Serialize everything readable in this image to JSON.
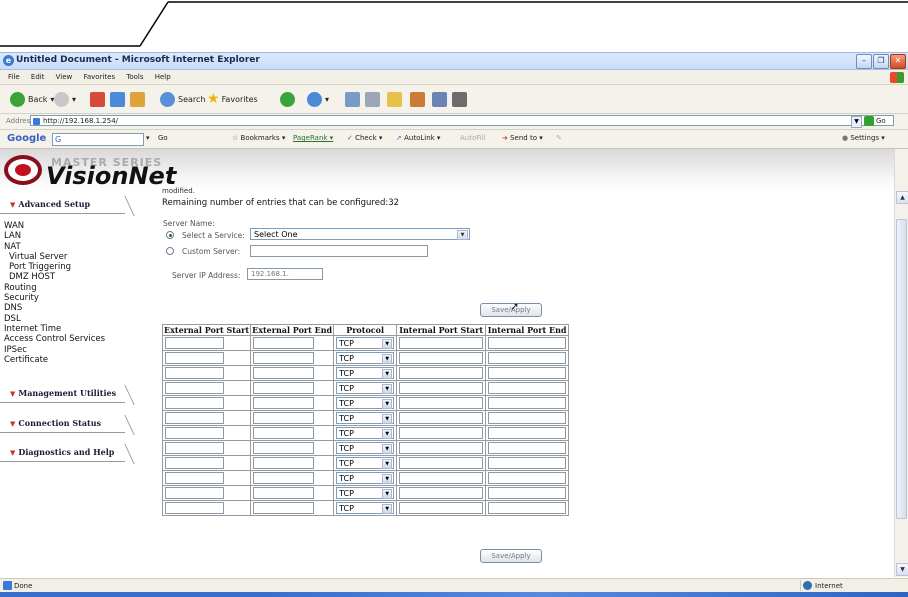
{
  "window": {
    "title": "Untitled Document - Microsoft Internet Explorer"
  },
  "menu": [
    "File",
    "Edit",
    "View",
    "Favorites",
    "Tools",
    "Help"
  ],
  "toolbar": {
    "back_label": "Back",
    "search_label": "Search",
    "favorites_label": "Favorites"
  },
  "address": {
    "label": "Address",
    "url": "http://192.168.1.254/",
    "go_label": "Go"
  },
  "google_bar": {
    "logo": "Google",
    "g_label": "G",
    "go_label": "Go",
    "bookmarks_label": "Bookmarks",
    "pagerank_label": "PageRank",
    "check_label": "Check",
    "autolink_label": "AutoLink",
    "autofill_label": "AutoFill",
    "sendto_label": "Send to",
    "settings_label": "Settings"
  },
  "brand": {
    "series": "MASTER SERIES",
    "name": "VisionNet"
  },
  "sidebar": {
    "advanced_setup": "Advanced Setup",
    "items": [
      {
        "label": "WAN",
        "sub": false
      },
      {
        "label": "LAN",
        "sub": false
      },
      {
        "label": "NAT",
        "sub": false
      },
      {
        "label": "Virtual Server",
        "sub": true
      },
      {
        "label": "Port Triggering",
        "sub": true
      },
      {
        "label": "DMZ HOST",
        "sub": true
      },
      {
        "label": "Routing",
        "sub": false
      },
      {
        "label": "Security",
        "sub": false
      },
      {
        "label": "DNS",
        "sub": false
      },
      {
        "label": "DSL",
        "sub": false
      },
      {
        "label": "Internet Time",
        "sub": false
      },
      {
        "label": "Access Control Services",
        "sub": false
      },
      {
        "label": "IPSec",
        "sub": false
      },
      {
        "label": "Certificate",
        "sub": false
      }
    ],
    "management_utilities": "Management Utilities",
    "connection_status": "Connection Status",
    "diagnostics_help": "Diagnostics and Help"
  },
  "main": {
    "modified_fragment": "modified.",
    "remaining": "Remaining number of entries that can be configured:32",
    "server_name_label": "Server Name:",
    "select_service_label": "Select a Service:",
    "select_service_value": "Select One",
    "custom_server_label": "Custom Server:",
    "custom_server_value": "",
    "server_ip_label": "Server IP Address:",
    "server_ip_value": "192.168.1.",
    "save_apply_label": "Save/Apply"
  },
  "table": {
    "headers": [
      "External Port Start",
      "External Port End",
      "Protocol",
      "Internal Port Start",
      "Internal Port End"
    ],
    "rows": [
      {
        "protocol": "TCP"
      },
      {
        "protocol": "TCP"
      },
      {
        "protocol": "TCP"
      },
      {
        "protocol": "TCP"
      },
      {
        "protocol": "TCP"
      },
      {
        "protocol": "TCP"
      },
      {
        "protocol": "TCP"
      },
      {
        "protocol": "TCP"
      },
      {
        "protocol": "TCP"
      },
      {
        "protocol": "TCP"
      },
      {
        "protocol": "TCP"
      },
      {
        "protocol": "TCP"
      }
    ]
  },
  "status": {
    "left": "Done",
    "zone": "Internet"
  }
}
